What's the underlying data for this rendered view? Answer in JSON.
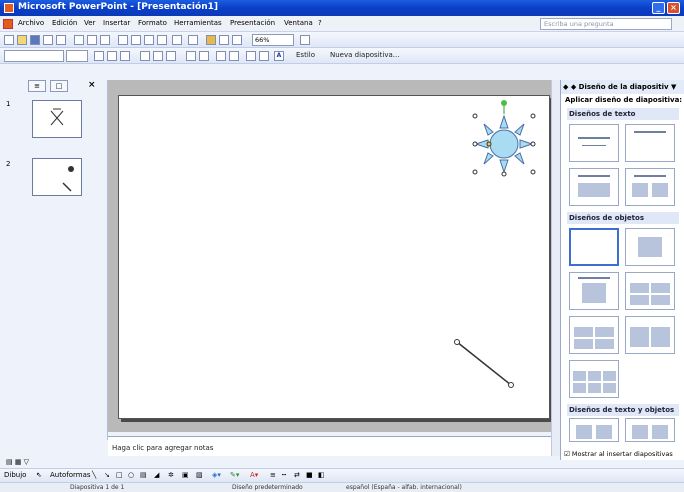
{
  "window": {
    "title": "Microsoft PowerPoint - [Presentación1]"
  },
  "menubar": {
    "items": [
      "Archivo",
      "Edición",
      "Ver",
      "Insertar",
      "Formato",
      "Herramientas",
      "Presentación",
      "Ventana",
      "?"
    ],
    "help_placeholder": "Escriba una pregunta"
  },
  "toolbar": {
    "zoom": "66%",
    "design_label": "Estilo",
    "new_slide_label": "Nueva diapositiva..."
  },
  "slides_pane": {
    "thumbs": [
      {
        "num": "1"
      },
      {
        "num": "2"
      }
    ]
  },
  "notes": {
    "placeholder": "Haga clic para agregar notas"
  },
  "taskpane": {
    "title": "Diseño de la diapositiv",
    "subtitle": "Aplicar diseño de diapositiva:",
    "sections": [
      "Diseños de texto",
      "Diseños de objetos",
      "Diseños de texto y objetos"
    ],
    "checkbox_label": "Mostrar al insertar diapositivas"
  },
  "drawbar": {
    "draw_label": "Dibujo",
    "autoshapes_label": "Autoformas"
  },
  "status": {
    "slide": "Diapositiva 1 de 1",
    "design": "Diseño predeterminado",
    "language": "español (España - alfab. internacional)"
  },
  "colors": {
    "title_bar": "#0a3fc8",
    "work_area": "#b9b9b9",
    "sun_fill": "#a9dcf2"
  }
}
